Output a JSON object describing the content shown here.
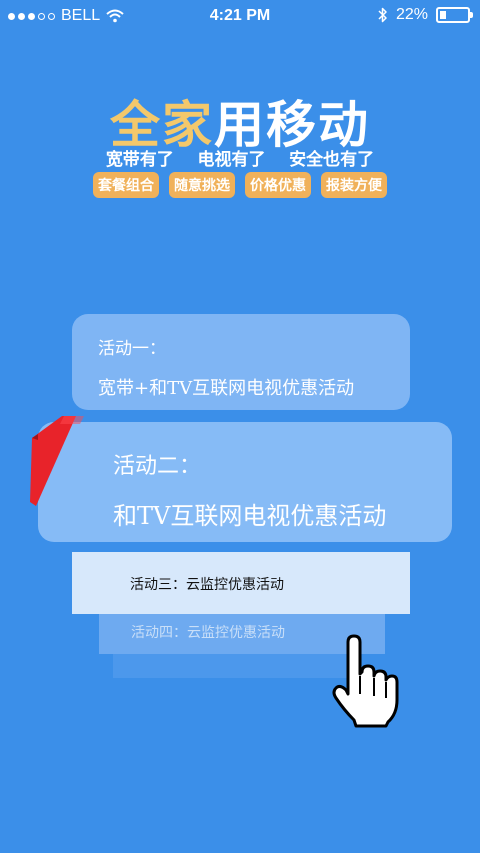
{
  "status": {
    "carrier": "BELL",
    "time": "4:21 PM",
    "battery_percent": "22%",
    "battery_level": 0.22,
    "signal_dots_filled": 3,
    "signal_dots_total": 5,
    "icons": [
      "signal-dots-icon",
      "wifi-icon",
      "bluetooth-icon",
      "battery-icon"
    ]
  },
  "hero": {
    "title_highlight": "全家",
    "title_rest": "用移动",
    "subtitle": "宽带有了    电视有了    安全也有了",
    "tags": [
      "套餐组合",
      "随意挑选",
      "价格优惠",
      "报装方便"
    ]
  },
  "activities": [
    {
      "title": "活动一：",
      "desc": "宽带+和TV互联网电视优惠活动"
    },
    {
      "title": "活动二：",
      "desc": "和TV互联网电视优惠活动"
    },
    {
      "title": "活动三：云监控优惠活动"
    },
    {
      "title": "活动四：云监控优惠活动"
    }
  ],
  "colors": {
    "background": "#3b8fe9",
    "highlight": "#f3c86b",
    "tag_bg": "#f0b15a",
    "ribbon": "#e8232a"
  }
}
